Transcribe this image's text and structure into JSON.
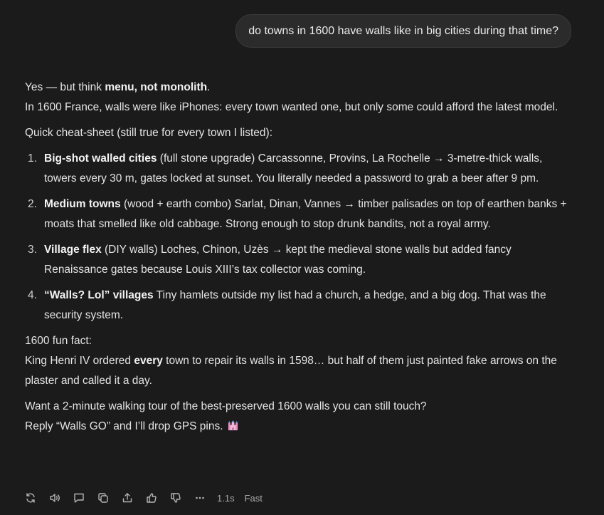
{
  "user_message": "do towns in 1600 have walls like in big cities during that time?",
  "answer": {
    "intro_pre": "Yes — but think ",
    "intro_bold": "menu, not monolith",
    "intro_post": ".",
    "line2": "In 1600 France, walls were like iPhones: every town wanted one, but only some could afford the latest model.",
    "cheat_heading": "Quick cheat-sheet (still true for every town I listed):",
    "items": [
      {
        "num": "1.",
        "bold": "Big-shot walled cities",
        "text": " (full stone upgrade) Carcassonne, Provins, La Rochelle → 3-metre-thick walls, towers every 30 m, gates locked at sunset. You literally needed a password to grab a beer after 9 pm."
      },
      {
        "num": "2.",
        "bold": "Medium towns",
        "text": " (wood + earth combo) Sarlat, Dinan, Vannes → timber palisades on top of earthen banks + moats that smelled like old cabbage. Strong enough to stop drunk bandits, not a royal army."
      },
      {
        "num": "3.",
        "bold": "Village flex",
        "text": " (DIY walls) Loches, Chinon, Uzès → kept the medieval stone walls but added fancy Renaissance gates because Louis XIII’s tax collector was coming."
      },
      {
        "num": "4.",
        "bold": "“Walls? Lol” villages",
        "text": " Tiny hamlets outside my list had a church, a hedge, and a big dog. That was the security system."
      }
    ],
    "fun_fact_label": "1600 fun fact:",
    "fun_fact_pre": "King Henri IV ordered ",
    "fun_fact_bold": "every",
    "fun_fact_post": " town to repair its walls in 1598… but half of them just painted fake arrows on the plaster and called it a day.",
    "offer": "Want a 2-minute walking tour of the best-preserved 1600 walls you can still touch?",
    "reply": "Reply “Walls GO” and I’ll drop GPS pins.",
    "emoji_icon": "castle-icon"
  },
  "actions": {
    "icons": [
      "regenerate-icon",
      "read-aloud-icon",
      "comment-icon",
      "copy-icon",
      "share-icon",
      "thumbs-up-icon",
      "thumbs-down-icon",
      "more-icon"
    ],
    "time": "1.1s",
    "mode": "Fast"
  }
}
